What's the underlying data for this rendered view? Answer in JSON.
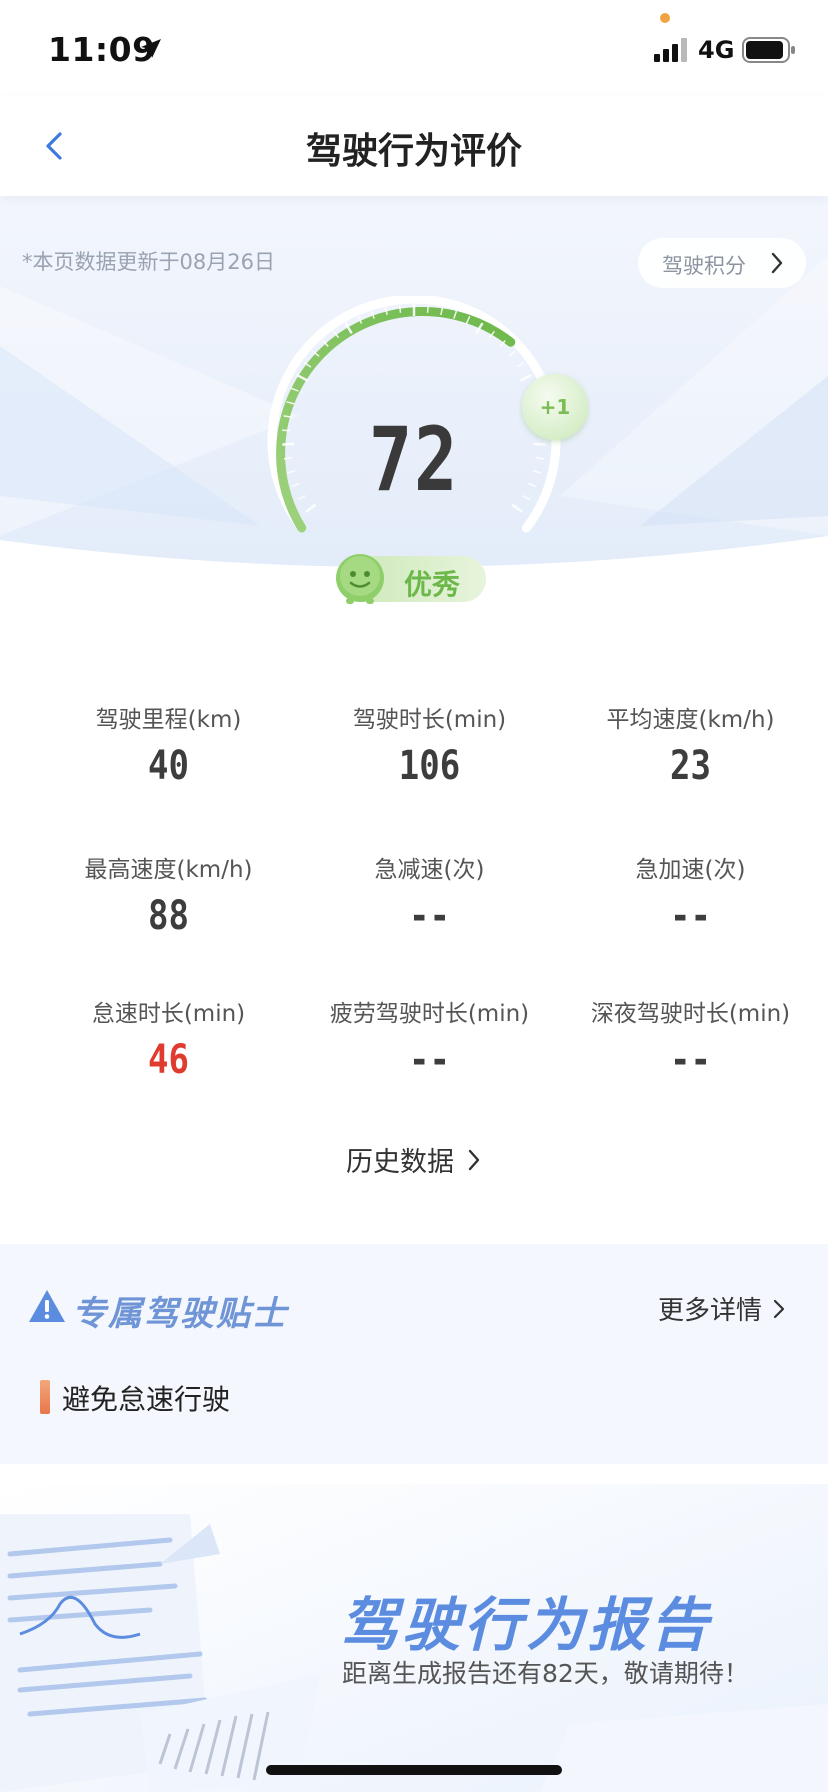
{
  "status": {
    "time": "11:09",
    "network": "4G"
  },
  "nav": {
    "title": "驾驶行为评价"
  },
  "hero": {
    "update_note": "*本页数据更新于08月26日",
    "points_label": "驾驶积分",
    "score": "72",
    "score_change": "+1",
    "level": "优秀"
  },
  "stats": [
    {
      "label": "驾驶里程(km)",
      "value": "40"
    },
    {
      "label": "驾驶时长(min)",
      "value": "106"
    },
    {
      "label": "平均速度(km/h)",
      "value": "23"
    },
    {
      "label": "最高速度(km/h)",
      "value": "88"
    },
    {
      "label": "急减速(次)",
      "value": "--"
    },
    {
      "label": "急加速(次)",
      "value": "--"
    },
    {
      "label": "怠速时长(min)",
      "value": "46"
    },
    {
      "label": "疲劳驾驶时长(min)",
      "value": "--"
    },
    {
      "label": "深夜驾驶时长(min)",
      "value": "--"
    }
  ],
  "history": {
    "label": "历史数据"
  },
  "tips": {
    "title": "专属驾驶贴士",
    "more_label": "更多详情",
    "items": [
      "避免怠速行驶"
    ]
  },
  "report": {
    "title": "驾驶行为报告",
    "subtitle": "距离生成报告还有82天，敬请期待！"
  },
  "colors": {
    "accent_blue": "#3d7be0",
    "gauge_green": "#7cc35a",
    "alert_red": "#e03b2f",
    "tip_orange": "#e8764a"
  }
}
